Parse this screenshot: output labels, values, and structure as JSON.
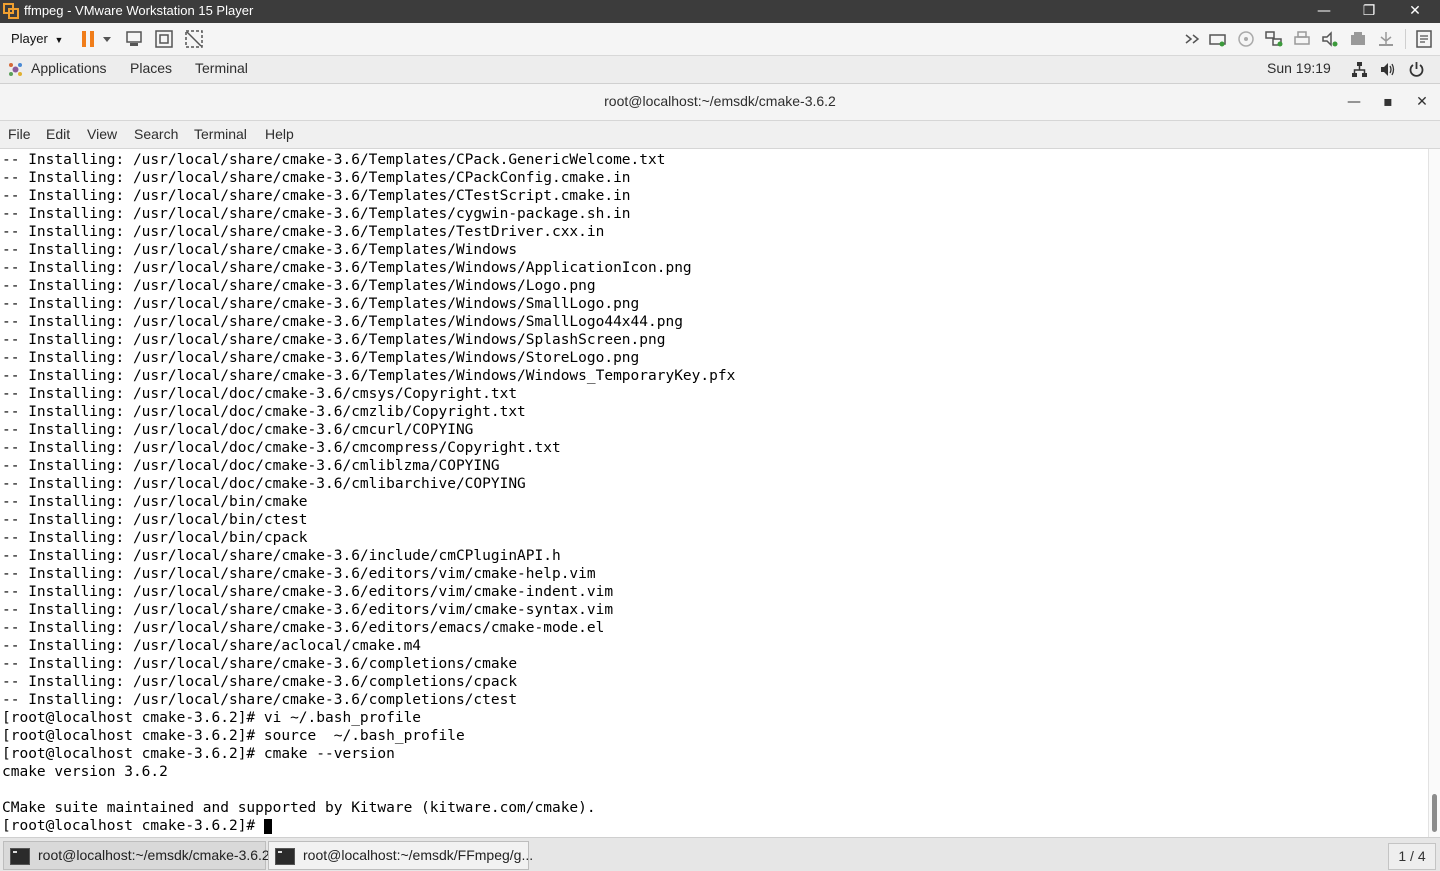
{
  "vmware": {
    "window_title": "ffmpeg - VMware Workstation 15 Player",
    "player_menu": "Player",
    "window_controls": {
      "minimize": "—",
      "restore": "❐",
      "close": "✕"
    },
    "toolbar_icons": [
      "pause-icon",
      "dropdown-icon",
      "send-ctrl-alt-del-icon",
      "fullscreen-icon",
      "unity-icon",
      "message-log-icon"
    ],
    "device_icons": [
      "forward-icon",
      "hard-disk-icon",
      "cd-dvd-icon",
      "network-adapter-icon",
      "printer-icon",
      "sound-card-icon",
      "usb-icon",
      "usb-controller-icon"
    ]
  },
  "gnome": {
    "applications": "Applications",
    "places": "Places",
    "terminal": "Terminal",
    "clock": "Sun 19:19"
  },
  "terminal_window": {
    "title": "root@localhost:~/emsdk/cmake-3.6.2",
    "controls": {
      "minimize": "—",
      "maximize": "▪",
      "close": "✕"
    },
    "menu": [
      "File",
      "Edit",
      "View",
      "Search",
      "Terminal",
      "Help"
    ]
  },
  "terminal": {
    "lines": [
      "-- Installing: /usr/local/share/cmake-3.6/Templates/CPack.GenericWelcome.txt",
      "-- Installing: /usr/local/share/cmake-3.6/Templates/CPackConfig.cmake.in",
      "-- Installing: /usr/local/share/cmake-3.6/Templates/CTestScript.cmake.in",
      "-- Installing: /usr/local/share/cmake-3.6/Templates/cygwin-package.sh.in",
      "-- Installing: /usr/local/share/cmake-3.6/Templates/TestDriver.cxx.in",
      "-- Installing: /usr/local/share/cmake-3.6/Templates/Windows",
      "-- Installing: /usr/local/share/cmake-3.6/Templates/Windows/ApplicationIcon.png",
      "-- Installing: /usr/local/share/cmake-3.6/Templates/Windows/Logo.png",
      "-- Installing: /usr/local/share/cmake-3.6/Templates/Windows/SmallLogo.png",
      "-- Installing: /usr/local/share/cmake-3.6/Templates/Windows/SmallLogo44x44.png",
      "-- Installing: /usr/local/share/cmake-3.6/Templates/Windows/SplashScreen.png",
      "-- Installing: /usr/local/share/cmake-3.6/Templates/Windows/StoreLogo.png",
      "-- Installing: /usr/local/share/cmake-3.6/Templates/Windows/Windows_TemporaryKey.pfx",
      "-- Installing: /usr/local/doc/cmake-3.6/cmsys/Copyright.txt",
      "-- Installing: /usr/local/doc/cmake-3.6/cmzlib/Copyright.txt",
      "-- Installing: /usr/local/doc/cmake-3.6/cmcurl/COPYING",
      "-- Installing: /usr/local/doc/cmake-3.6/cmcompress/Copyright.txt",
      "-- Installing: /usr/local/doc/cmake-3.6/cmliblzma/COPYING",
      "-- Installing: /usr/local/doc/cmake-3.6/cmlibarchive/COPYING",
      "-- Installing: /usr/local/bin/cmake",
      "-- Installing: /usr/local/bin/ctest",
      "-- Installing: /usr/local/bin/cpack",
      "-- Installing: /usr/local/share/cmake-3.6/include/cmCPluginAPI.h",
      "-- Installing: /usr/local/share/cmake-3.6/editors/vim/cmake-help.vim",
      "-- Installing: /usr/local/share/cmake-3.6/editors/vim/cmake-indent.vim",
      "-- Installing: /usr/local/share/cmake-3.6/editors/vim/cmake-syntax.vim",
      "-- Installing: /usr/local/share/cmake-3.6/editors/emacs/cmake-mode.el",
      "-- Installing: /usr/local/share/aclocal/cmake.m4",
      "-- Installing: /usr/local/share/cmake-3.6/completions/cmake",
      "-- Installing: /usr/local/share/cmake-3.6/completions/cpack",
      "-- Installing: /usr/local/share/cmake-3.6/completions/ctest",
      "[root@localhost cmake-3.6.2]# vi ~/.bash_profile",
      "[root@localhost cmake-3.6.2]# source  ~/.bash_profile",
      "[root@localhost cmake-3.6.2]# cmake --version",
      "cmake version 3.6.2",
      "",
      "CMake suite maintained and supported by Kitware (kitware.com/cmake).",
      "[root@localhost cmake-3.6.2]# "
    ]
  },
  "taskbar": {
    "tasks": [
      {
        "label": "root@localhost:~/emsdk/cmake-3.6.2"
      },
      {
        "label": "root@localhost:~/emsdk/FFmpeg/g..."
      }
    ],
    "workspace": "1 / 4"
  },
  "colors": {
    "vm_titlebar": "#3c3c3c",
    "pause_orange": "#f07d1a",
    "terminal_bg": "#ffffff",
    "terminal_fg": "#000000"
  }
}
